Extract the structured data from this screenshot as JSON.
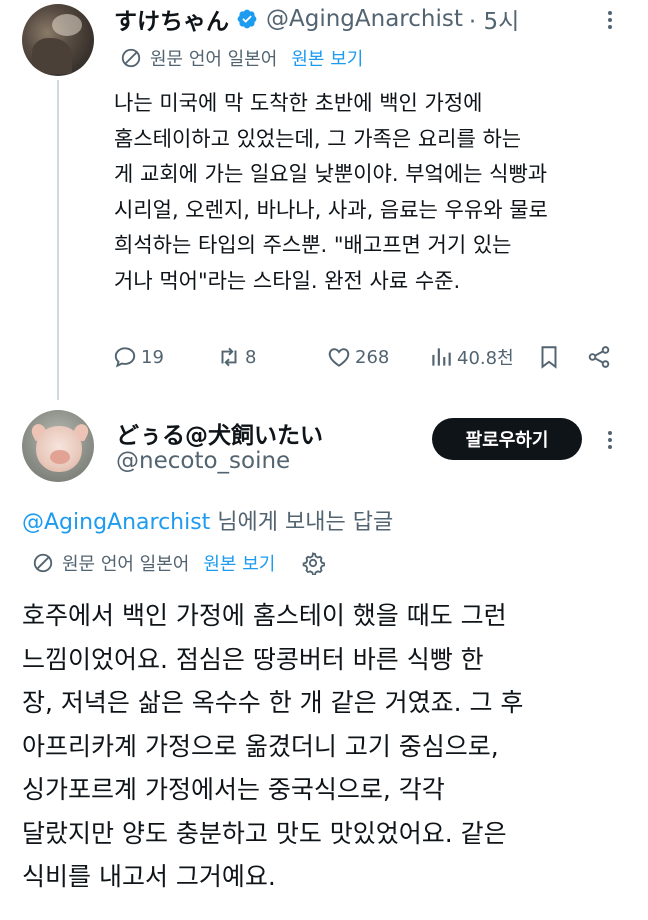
{
  "colors": {
    "text": "#0f1419",
    "secondary": "#536471",
    "accent": "#1d9bf0",
    "verified": "#1d9bf0",
    "button_bg": "#0f1419"
  },
  "tweet": {
    "author_name": "すけちゃん",
    "verified_icon": "verified-badge-icon",
    "handle": "@AgingAnarchist",
    "time": "· 5시",
    "translate": {
      "source_label": "원문 언어 일본어",
      "view_original_label": "원본 보기"
    },
    "body_lines": [
      "나는 미국에 막 도착한 초반에 백인 가정에",
      "홈스테이하고 있었는데, 그 가족은 요리를 하는",
      "게 교회에 가는 일요일 낮뿐이야. 부엌에는 식빵과",
      "시리얼, 오렌지, 바나나, 사과, 음료는 우유와 물로",
      "희석하는 타입의 주스뿐. \"배고프면 거기 있는",
      "거나 먹어\"라는 스타일. 완전 사료 수준."
    ],
    "actions": {
      "replies": "19",
      "retweets": "8",
      "likes": "268",
      "views": "40.8천"
    }
  },
  "reply": {
    "author_name": "どぅる@犬飼いたい",
    "handle": "@necoto_soine",
    "follow_label": "팔로우하기",
    "replying_to_mention": "@AgingAnarchist",
    "replying_to_suffix": " 님에게 보내는 답글",
    "translate": {
      "source_label": "원문 언어 일본어",
      "view_original_label": "원본 보기"
    },
    "body_lines": [
      "호주에서 백인 가정에 홈스테이 했을 때도 그런",
      "느낌이었어요. 점심은 땅콩버터 바른 식빵 한",
      "장, 저녁은 삶은 옥수수 한 개 같은 거였죠. 그 후",
      "아프리카계 가정으로 옮겼더니 고기 중심으로,",
      "싱가포르계 가정에서는 중국식으로, 각각",
      "달랐지만 양도 충분하고 맛도 맛있었어요. 같은",
      "식비를 내고서 그거예요."
    ]
  }
}
